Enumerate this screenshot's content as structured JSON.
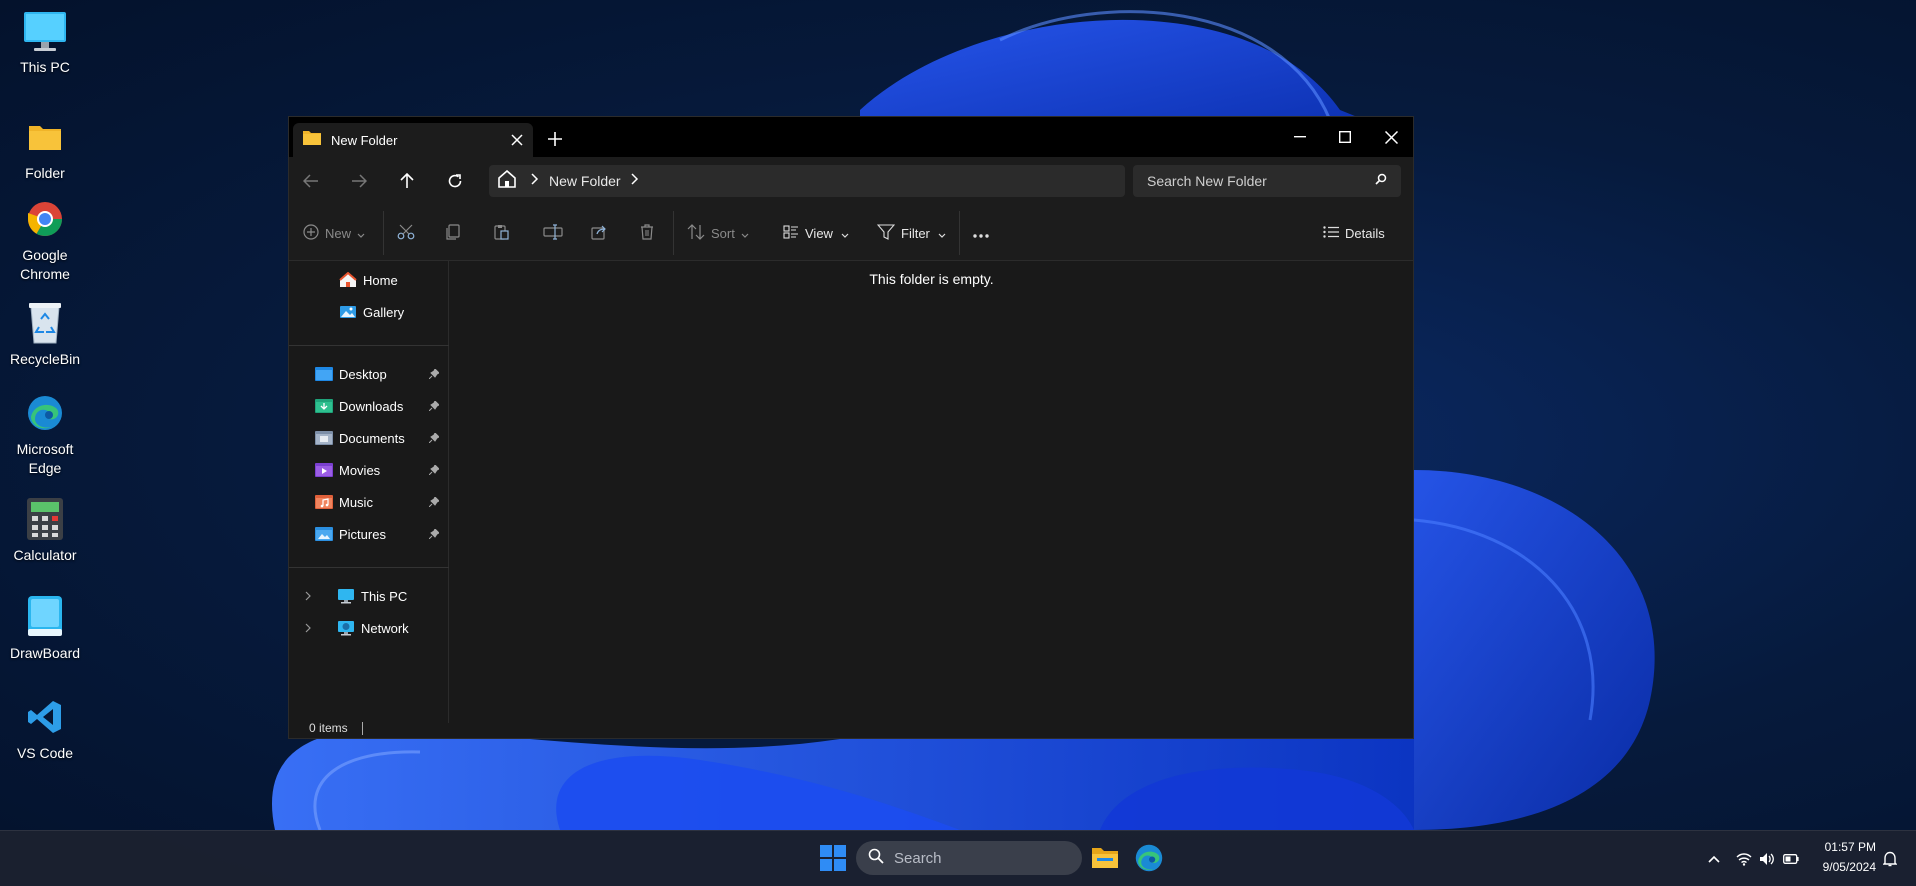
{
  "desktop": {
    "icons": [
      {
        "label": "This PC",
        "icon": "monitor-icon"
      },
      {
        "label": "Folder",
        "icon": "folder-icon"
      },
      {
        "label": "Google Chrome",
        "icon": "chrome-icon"
      },
      {
        "label": "RecycleBin",
        "icon": "recycle-bin-icon"
      },
      {
        "label": "Microsoft Edge",
        "icon": "edge-icon"
      },
      {
        "label": "Calculator",
        "icon": "calculator-icon"
      },
      {
        "label": "DrawBoard",
        "icon": "drawboard-icon"
      },
      {
        "label": "VS Code",
        "icon": "vscode-icon"
      }
    ]
  },
  "explorer": {
    "tab_title": "New Folder",
    "breadcrumb": {
      "current": "New Folder"
    },
    "search": {
      "placeholder": "Search New Folder"
    },
    "toolbar": {
      "new_label": "New",
      "sort_label": "Sort",
      "view_label": "View",
      "filter_label": "Filter",
      "details_label": "Details"
    },
    "sidebar": {
      "top": [
        {
          "label": "Home",
          "icon": "home-icon"
        },
        {
          "label": "Gallery",
          "icon": "gallery-icon"
        }
      ],
      "pinned": [
        {
          "label": "Desktop",
          "icon": "desktop-folder-icon"
        },
        {
          "label": "Downloads",
          "icon": "downloads-folder-icon"
        },
        {
          "label": "Documents",
          "icon": "documents-folder-icon"
        },
        {
          "label": "Movies",
          "icon": "movies-folder-icon"
        },
        {
          "label": "Music",
          "icon": "music-folder-icon"
        },
        {
          "label": "Pictures",
          "icon": "pictures-folder-icon"
        }
      ],
      "tree": [
        {
          "label": "This PC",
          "icon": "this-pc-icon"
        },
        {
          "label": "Network",
          "icon": "network-icon"
        }
      ]
    },
    "content": {
      "empty_message": "This folder is empty."
    },
    "status": {
      "items": "0 items"
    }
  },
  "taskbar": {
    "search_placeholder": "Search",
    "clock": {
      "time": "01:57 PM",
      "date": "9/05/2024"
    }
  },
  "colors": {
    "accent": "#0078d4",
    "folder_yellow": "#f8c33a",
    "window_bg": "#191919"
  }
}
